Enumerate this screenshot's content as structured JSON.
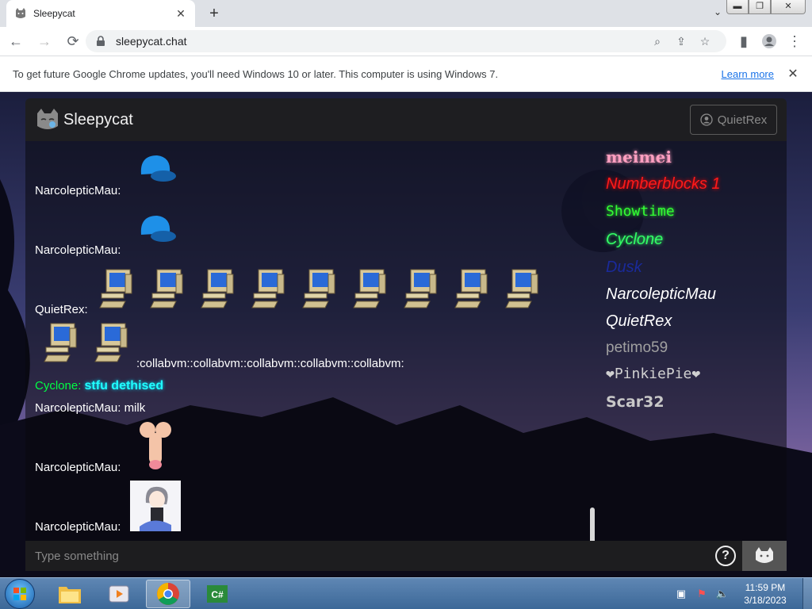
{
  "browser": {
    "tab_title": "Sleepycat",
    "tab_close": "✕",
    "new_tab": "+",
    "url": "sleepycat.chat",
    "window_controls": {
      "minimize": "▬",
      "restore": "❐",
      "close": "✕"
    }
  },
  "infobar": {
    "message": "To get future Google Chrome updates, you'll need Windows 10 or later. This computer is using Windows 7.",
    "link": "Learn more",
    "close": "✕"
  },
  "app": {
    "title": "Sleepycat",
    "current_user": "QuietRex",
    "input_placeholder": "Type something",
    "help_label": "?"
  },
  "messages": [
    {
      "author": "NarcolepticMau:",
      "content": "",
      "attachment": "blue-cap-emote"
    },
    {
      "author": "NarcolepticMau:",
      "content": "",
      "attachment": "blue-cap-emote"
    },
    {
      "author": "QuietRex:",
      "content": ":collabvm::collabvm::collabvm::collabvm::collabvm:",
      "attachment": "collabvm-emote x11"
    },
    {
      "author": "Cyclone:",
      "content": "stfu dethised",
      "color": "#00ff44",
      "content_color": "#20ffff"
    },
    {
      "author": "NarcolepticMau:",
      "content": "milk"
    },
    {
      "author": "NarcolepticMau:",
      "content": "",
      "attachment": "emote-image"
    },
    {
      "author": "NarcolepticMau:",
      "content": "",
      "attachment": "anime-girl-image"
    }
  ],
  "users": [
    {
      "name": "meimei",
      "color": "#ff9fc0"
    },
    {
      "name": "Numberblocks 1",
      "color": "#ff1a1a"
    },
    {
      "name": "Showtime",
      "color": "#33ff33"
    },
    {
      "name": "Cyclone",
      "color": "#33ff66"
    },
    {
      "name": "Dusk",
      "color": "#1a2a9a"
    },
    {
      "name": "NarcolepticMau",
      "color": "#ffffff"
    },
    {
      "name": "QuietRex",
      "color": "#ffffff"
    },
    {
      "name": "petimo59",
      "color": "#a0a0a0"
    },
    {
      "name": "❤PinkiePie❤",
      "color": "#d0d0d0"
    },
    {
      "name": "Scar32",
      "color": "#c8c8c8"
    }
  ],
  "taskbar": {
    "apps": [
      "windows-explorer",
      "media-player",
      "google-chrome",
      "csharp-ide"
    ],
    "time": "11:59 PM",
    "date": "3/18/2023"
  }
}
